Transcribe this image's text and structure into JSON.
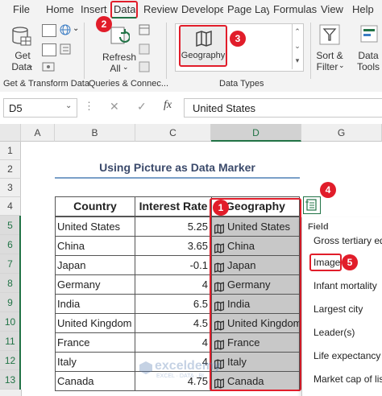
{
  "menu": {
    "file": "File",
    "home": "Home",
    "insert": "Insert",
    "data": "Data",
    "review": "Review",
    "developer": "Develope",
    "page_layout": "Page Layo",
    "formulas": "Formulas",
    "view": "View",
    "help": "Help"
  },
  "ribbon": {
    "get_data": "Get\nData",
    "get_data_line1": "Get",
    "get_data_line2": "Data",
    "refresh_line1": "Refresh",
    "refresh_line2": "All",
    "geography": "Geography",
    "sort_line1": "Sort &",
    "sort_line2": "Filter",
    "data_tools_line1": "Data",
    "data_tools_line2": "Tools",
    "group_get_transform": "Get & Transform Data",
    "group_queries": "Queries & Connec...",
    "group_data_types": "Data Types"
  },
  "formula_bar": {
    "name_box": "D5",
    "fx": "fx",
    "value": "United States"
  },
  "columns": [
    "A",
    "B",
    "C",
    "D",
    "G"
  ],
  "rows": [
    "1",
    "2",
    "3",
    "4",
    "5",
    "6",
    "7",
    "8",
    "9",
    "10",
    "11",
    "12",
    "13"
  ],
  "sheet": {
    "title": "Using Picture as Data Marker",
    "headers": {
      "country": "Country",
      "rate": "Interest Rate",
      "geo": "Geography"
    },
    "data": [
      {
        "country": "United States",
        "rate": "5.25",
        "geo": "United States"
      },
      {
        "country": "China",
        "rate": "3.65",
        "geo": "China"
      },
      {
        "country": "Japan",
        "rate": "-0.1",
        "geo": "Japan"
      },
      {
        "country": "Germany",
        "rate": "4",
        "geo": "Germany"
      },
      {
        "country": "India",
        "rate": "6.5",
        "geo": "India"
      },
      {
        "country": "United Kingdom",
        "rate": "4.5",
        "geo": "United Kingdom"
      },
      {
        "country": "France",
        "rate": "4",
        "geo": "France"
      },
      {
        "country": "Italy",
        "rate": "4",
        "geo": "Italy"
      },
      {
        "country": "Canada",
        "rate": "4.75",
        "geo": "Canada"
      }
    ]
  },
  "field_panel": {
    "header": "Field",
    "items": [
      "Gross tertiary edu",
      "Image",
      "Infant mortality",
      "Largest city",
      "Leader(s)",
      "Life expectancy",
      "Market cap of list"
    ]
  },
  "steps": [
    "1",
    "2",
    "3",
    "4",
    "5"
  ],
  "watermark": {
    "name": "exceldemy",
    "tagline": "EXCEL · DATA · BI"
  },
  "colors": {
    "accent_red": "#e11d2a",
    "excel_green": "#217346",
    "selected_fill": "#c8c8c8"
  }
}
